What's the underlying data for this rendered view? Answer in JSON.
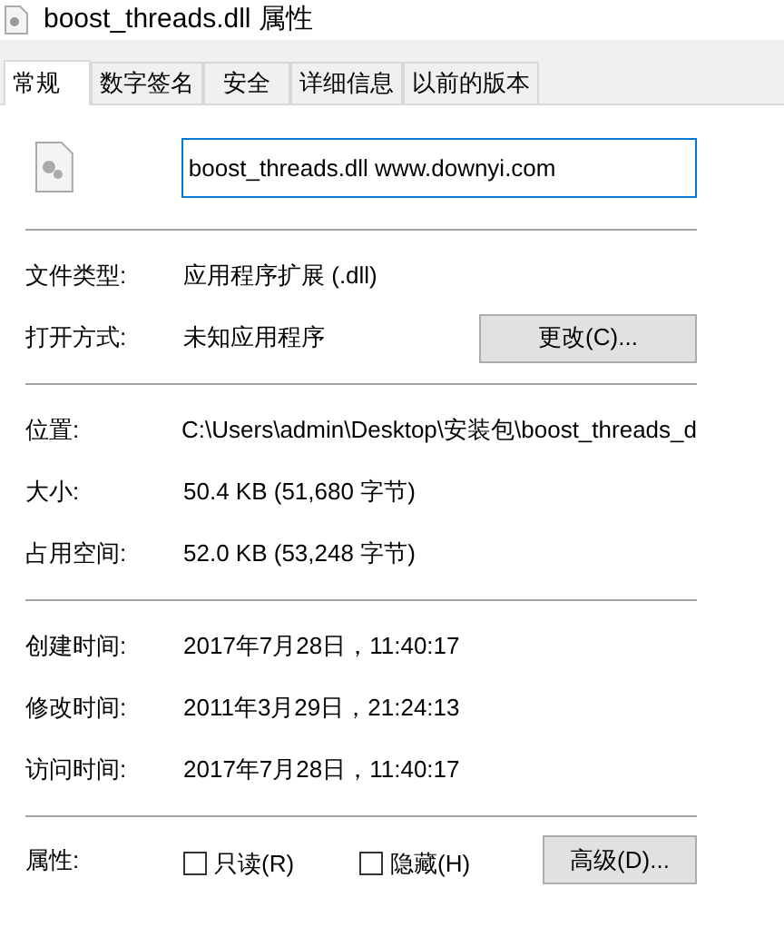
{
  "window": {
    "title": "boost_threads.dll 属性"
  },
  "tabs": [
    {
      "label": "常规",
      "selected": true
    },
    {
      "label": "数字签名",
      "selected": false
    },
    {
      "label": "安全",
      "selected": false
    },
    {
      "label": "详细信息",
      "selected": false
    },
    {
      "label": "以前的版本",
      "selected": false
    }
  ],
  "name_field": {
    "value": "boost_threads.dll www.downyi.com"
  },
  "sections": [
    [
      {
        "label": "文件类型:",
        "value": "应用程序扩展 (.dll)"
      },
      {
        "label": "打开方式:",
        "value": "未知应用程序",
        "button": "更改(C)..."
      }
    ],
    [
      {
        "label": "位置:",
        "value": "C:\\Users\\admin\\Desktop\\安装包\\boost_threads_d"
      },
      {
        "label": "大小:",
        "value": "50.4 KB (51,680 字节)"
      },
      {
        "label": "占用空间:",
        "value": "52.0 KB (53,248 字节)"
      }
    ],
    [
      {
        "label": "创建时间:",
        "value": "2017年7月28日，11:40:17"
      },
      {
        "label": "修改时间:",
        "value": "2011年3月29日，21:24:13"
      },
      {
        "label": "访问时间:",
        "value": "2017年7月28日，11:40:17"
      }
    ]
  ],
  "attributes": {
    "label": "属性:",
    "checkboxes": [
      {
        "label": "只读(R)",
        "checked": false
      },
      {
        "label": "隐藏(H)",
        "checked": false
      }
    ],
    "button": "高级(D)..."
  }
}
